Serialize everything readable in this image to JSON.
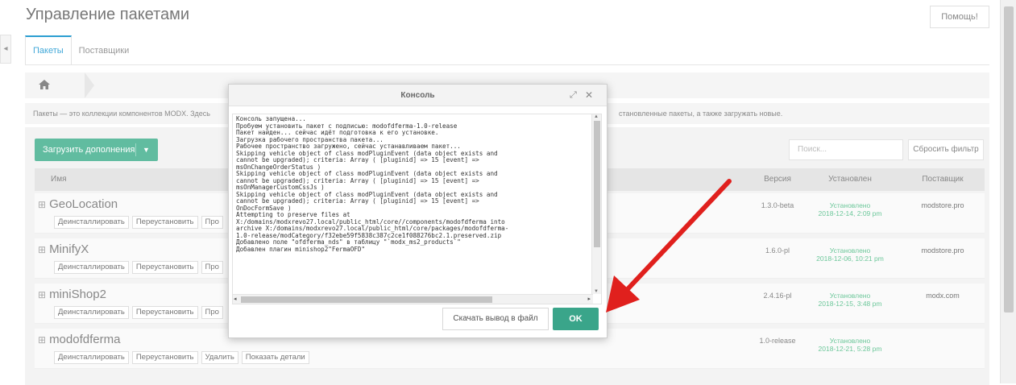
{
  "page": {
    "title": "Управление пакетами",
    "help_label": "Помощь!",
    "tabs": [
      {
        "label": "Пакеты",
        "active": true
      },
      {
        "label": "Поставщики",
        "active": false
      }
    ],
    "description_left": "Пакеты — это коллекции компонентов MODX. Здесь",
    "description_right": "становленные пакеты, а также загружать новые."
  },
  "toolbar": {
    "upload_label": "Загрузить дополнения",
    "search_placeholder": "Поиск...",
    "reset_label": "Сбросить фильтр"
  },
  "grid": {
    "columns": {
      "name": "Имя",
      "version": "Версия",
      "installed": "Установлен",
      "vendor": "Поставщик"
    },
    "action_labels": [
      "Деинсталлировать",
      "Переустановить",
      "Про"
    ],
    "last_row_actions": [
      "Деинсталлировать",
      "Переустановить",
      "Удалить",
      "Показать детали"
    ],
    "rows": [
      {
        "name": "GeoLocation",
        "version": "1.3.0-beta",
        "status": "Установлено",
        "date": "2018-12-14, 2:09 pm",
        "vendor": "modstore.pro"
      },
      {
        "name": "MinifyX",
        "version": "1.6.0-pl",
        "status": "Установлено",
        "date": "2018-12-06, 10:21 pm",
        "vendor": "modstore.pro"
      },
      {
        "name": "miniShop2",
        "version": "2.4.16-pl",
        "status": "Установлено",
        "date": "2018-12-15, 3:48 pm",
        "vendor": "modx.com"
      },
      {
        "name": "modofdferma",
        "version": "1.0-release",
        "status": "Установлено",
        "date": "2018-12-21, 5:28 pm",
        "vendor": ""
      }
    ]
  },
  "dialog": {
    "title": "Консоль",
    "lines": [
      "Консоль запущена...",
      "Пробуем установить пакет с подписью: modofdferma-1.0-release",
      "Пакет найден... сейчас идёт подготовка к его установке.",
      "Загрузка рабочего пространства пакета...",
      "Рабочее пространство загружено, сейчас устанавливаем пакет...",
      "Skipping vehicle object of class modPluginEvent (data object exists and",
      "cannot be upgraded); criteria: Array ( [pluginid] => 15 [event] =>",
      "msOnChangeOrderStatus )",
      "Skipping vehicle object of class modPluginEvent (data object exists and",
      "cannot be upgraded); criteria: Array ( [pluginid] => 15 [event] =>",
      "msOnManagerCustomCssJs )",
      "Skipping vehicle object of class modPluginEvent (data object exists and",
      "cannot be upgraded); criteria: Array ( [pluginid] => 15 [event] =>",
      "OnDocFormSave )",
      "Attempting to preserve files at",
      "X:/domains/modxrevo27.local/public_html/core//components/modofdferma into",
      "archive X:/domains/modxrevo27.local/public_html/core/packages/modofdferma-",
      "1.0-release/modCategory/f32ebe59f5838c387c2ce1f088276bc2.1.preserved.zip",
      "Добавлено поле \"ofdferma_nds\" в таблицу \"`modx_ms2_products`\"",
      "Добавлен плагин minishop2\"FermaOFD\""
    ],
    "download_label": "Скачать вывод в файл",
    "ok_label": "OK"
  },
  "colors": {
    "accent": "#61bca0",
    "ok": "#3aa58a",
    "installed": "#6cc79a",
    "arrow": "#e0201d"
  }
}
